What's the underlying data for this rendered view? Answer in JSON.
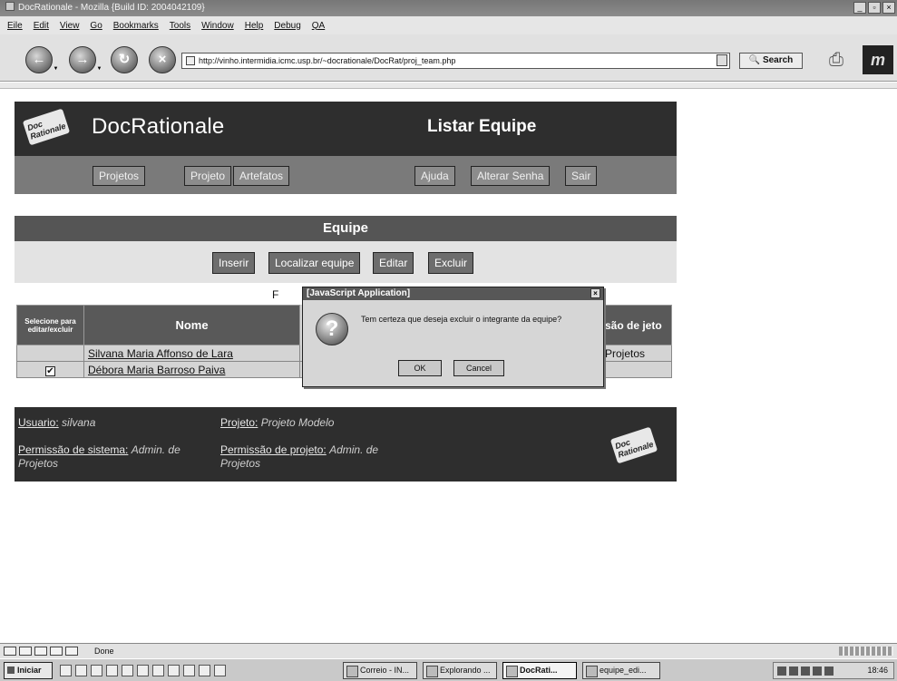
{
  "window": {
    "title": "DocRationale - Mozilla {Build ID: 2004042109}"
  },
  "menu": [
    "Eile",
    "Edit",
    "View",
    "Go",
    "Bookmarks",
    "Tools",
    "Window",
    "Help",
    "Debug",
    "QA"
  ],
  "navbar": {
    "url": "http://vinho.intermidia.icmc.usp.br/~docrationale/DocRat/proj_team.php",
    "search_label": "Search"
  },
  "header": {
    "brand": "DocRationale",
    "page_title": "Listar Equipe",
    "logo_text": "Doc Rationale"
  },
  "toolbar": {
    "projetos": "Projetos",
    "projeto": "Projeto",
    "artefatos": "Artefatos",
    "ajuda": "Ajuda",
    "alterar_senha": "Alterar Senha",
    "sair": "Sair"
  },
  "section": {
    "title": "Equipe",
    "inserir": "Inserir",
    "localizar": "Localizar equipe",
    "editar": "Editar",
    "excluir": "Excluir",
    "label_fragment": "F"
  },
  "table": {
    "header_select": "Selecione para editar/excluir",
    "header_name": "Nome",
    "header_perm": "são de jeto",
    "rows": [
      {
        "checked": false,
        "name": "Silvana Maria Affonso de Lara",
        "perm": "Projetos"
      },
      {
        "checked": true,
        "name": "Débora Maria Barroso Paiva",
        "perm": ""
      }
    ],
    "check_mark": "✔"
  },
  "dialog": {
    "title": "[JavaScript Application]",
    "message": "Tem certeza que deseja excluir o integrante da equipe?",
    "ok": "OK",
    "cancel": "Cancel",
    "close": "×",
    "icon": "?"
  },
  "footer": {
    "usuario_label": "Usuario:",
    "usuario_value": "silvana",
    "projeto_label": "Projeto:",
    "projeto_value": "Projeto Modelo",
    "perm_sistema_label": "Permissão de sistema:",
    "perm_sistema_value": "Admin. de Projetos",
    "perm_projeto_label": "Permissão de projeto:",
    "perm_projeto_value": "Admin. de Projetos"
  },
  "statusbar": {
    "text": "Done"
  },
  "taskbar": {
    "start": "Iniciar",
    "tasks": [
      "Correio - IN...",
      "Explorando ...",
      "DocRati...",
      "equipe_edi..."
    ],
    "clock": "18:46"
  }
}
